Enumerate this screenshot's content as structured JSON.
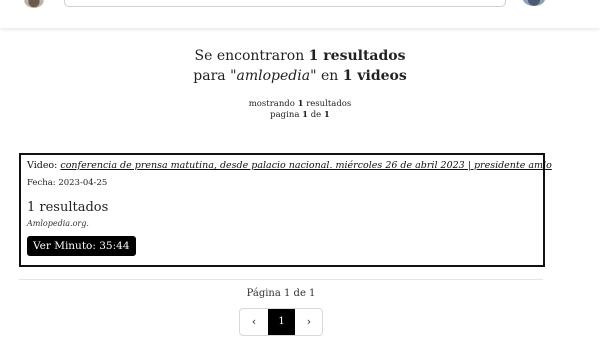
{
  "header": {
    "logo_icon": "amlopedia-logo",
    "search_placeholder": "",
    "avatar_icon": "user-avatar"
  },
  "summary": {
    "line1_prefix": "Se encontraron",
    "line1_count": "1 resultados",
    "line2_prefix": "para",
    "query": "\"amlopedia\"",
    "line2_mid": "en",
    "line2_count": "1 videos",
    "showing_prefix": "mostrando",
    "showing_count": "1",
    "showing_suffix": "resultados",
    "page_prefix": "pagina",
    "page_current": "1",
    "page_of": "de",
    "page_total": "1"
  },
  "result": {
    "video_label": "Video:",
    "video_title": "conferencia de prensa matutina, desde palacio nacional. miércoles 26 de abril 2023 | presidente amlo",
    "date_text": "Fecha: 2023-04-25",
    "count_text": "1 resultados",
    "source_text": "Amlopedia.org.",
    "minute_button": "Ver Minuto: 35:44"
  },
  "pagination": {
    "label": "Página 1 de 1",
    "prev": "‹",
    "current": "1",
    "next": "›"
  },
  "colors": {
    "accent": "#000000",
    "border": "#111111",
    "background": "#ffffff"
  }
}
